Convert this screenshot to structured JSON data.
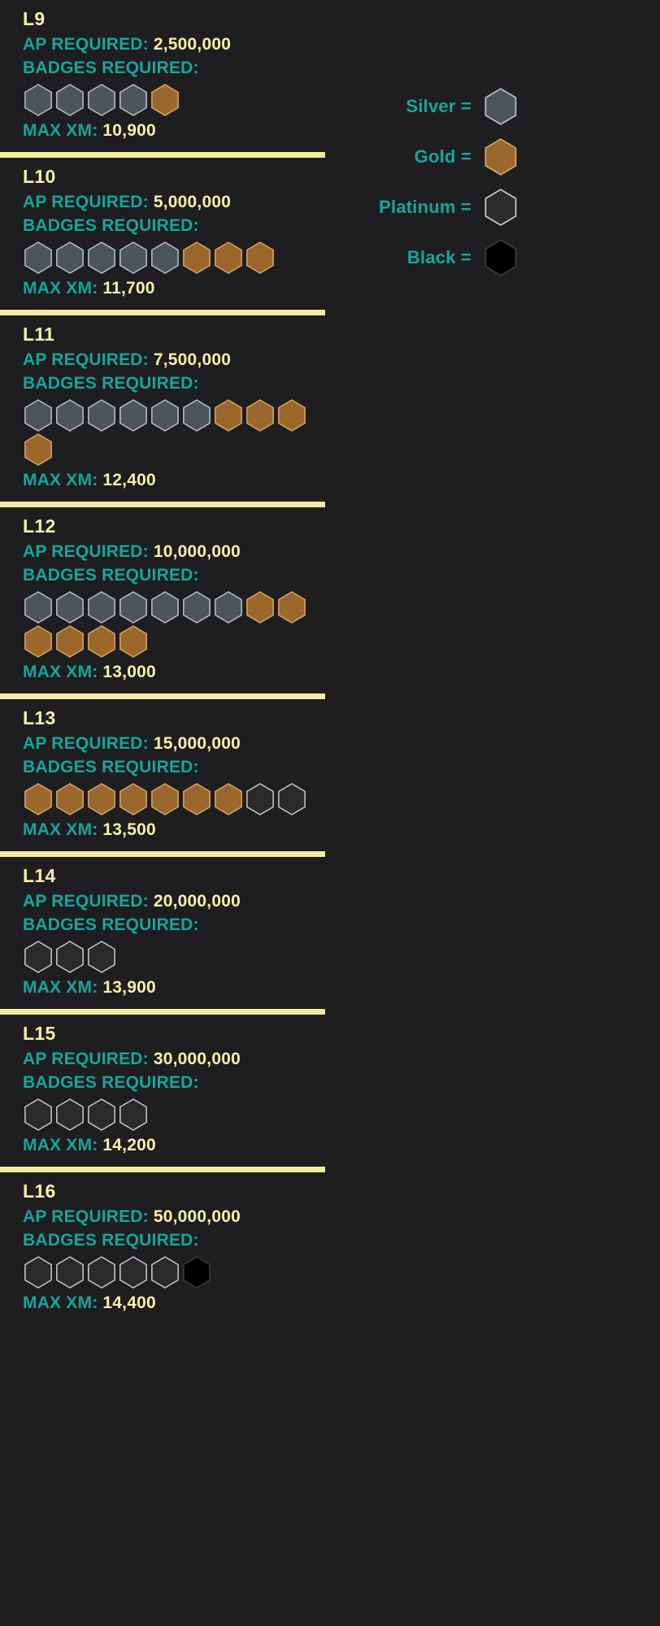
{
  "colors": {
    "background": "#1e1e20",
    "value_text": "#f6f0a8",
    "label_text": "#16a69c",
    "separator": "#f2eda2",
    "silver_fill": "#4c5558",
    "silver_stroke": "#b9bfc0",
    "gold_fill": "#9a672c",
    "gold_stroke": "#d8a663",
    "platinum_fill": "#2a2a2c",
    "platinum_stroke": "#c9c9cc",
    "black_fill": "#000000",
    "black_stroke": "#3a3a3c"
  },
  "labels": {
    "ap_required": "AP REQUIRED:",
    "badges_required": "BADGES REQUIRED:",
    "max_xm": "MAX XM:"
  },
  "legend": {
    "items": [
      {
        "label": "Silver =",
        "type": "silver"
      },
      {
        "label": "Gold =",
        "type": "gold"
      },
      {
        "label": "Platinum =",
        "type": "platinum"
      },
      {
        "label": "Black =",
        "type": "black"
      }
    ]
  },
  "levels": [
    {
      "name": "L9",
      "ap_required": "2,500,000",
      "max_xm": "10,900",
      "badges": [
        "silver",
        "silver",
        "silver",
        "silver",
        "gold"
      ]
    },
    {
      "name": "L10",
      "ap_required": "5,000,000",
      "max_xm": "11,700",
      "badges": [
        "silver",
        "silver",
        "silver",
        "silver",
        "silver",
        "gold",
        "gold",
        "gold"
      ]
    },
    {
      "name": "L11",
      "ap_required": "7,500,000",
      "max_xm": "12,400",
      "badges": [
        "silver",
        "silver",
        "silver",
        "silver",
        "silver",
        "silver",
        "gold",
        "gold",
        "gold",
        "gold"
      ]
    },
    {
      "name": "L12",
      "ap_required": "10,000,000",
      "max_xm": "13,000",
      "badges": [
        "silver",
        "silver",
        "silver",
        "silver",
        "silver",
        "silver",
        "silver",
        "gold",
        "gold",
        "gold",
        "gold",
        "gold",
        "gold"
      ]
    },
    {
      "name": "L13",
      "ap_required": "15,000,000",
      "max_xm": "13,500",
      "badges": [
        "gold",
        "gold",
        "gold",
        "gold",
        "gold",
        "gold",
        "gold",
        "platinum",
        "platinum"
      ]
    },
    {
      "name": "L14",
      "ap_required": "20,000,000",
      "max_xm": "13,900",
      "badges": [
        "platinum",
        "platinum",
        "platinum"
      ]
    },
    {
      "name": "L15",
      "ap_required": "30,000,000",
      "max_xm": "14,200",
      "badges": [
        "platinum",
        "platinum",
        "platinum",
        "platinum"
      ]
    },
    {
      "name": "L16",
      "ap_required": "50,000,000",
      "max_xm": "14,400",
      "badges": [
        "platinum",
        "platinum",
        "platinum",
        "platinum",
        "platinum",
        "black"
      ]
    }
  ]
}
